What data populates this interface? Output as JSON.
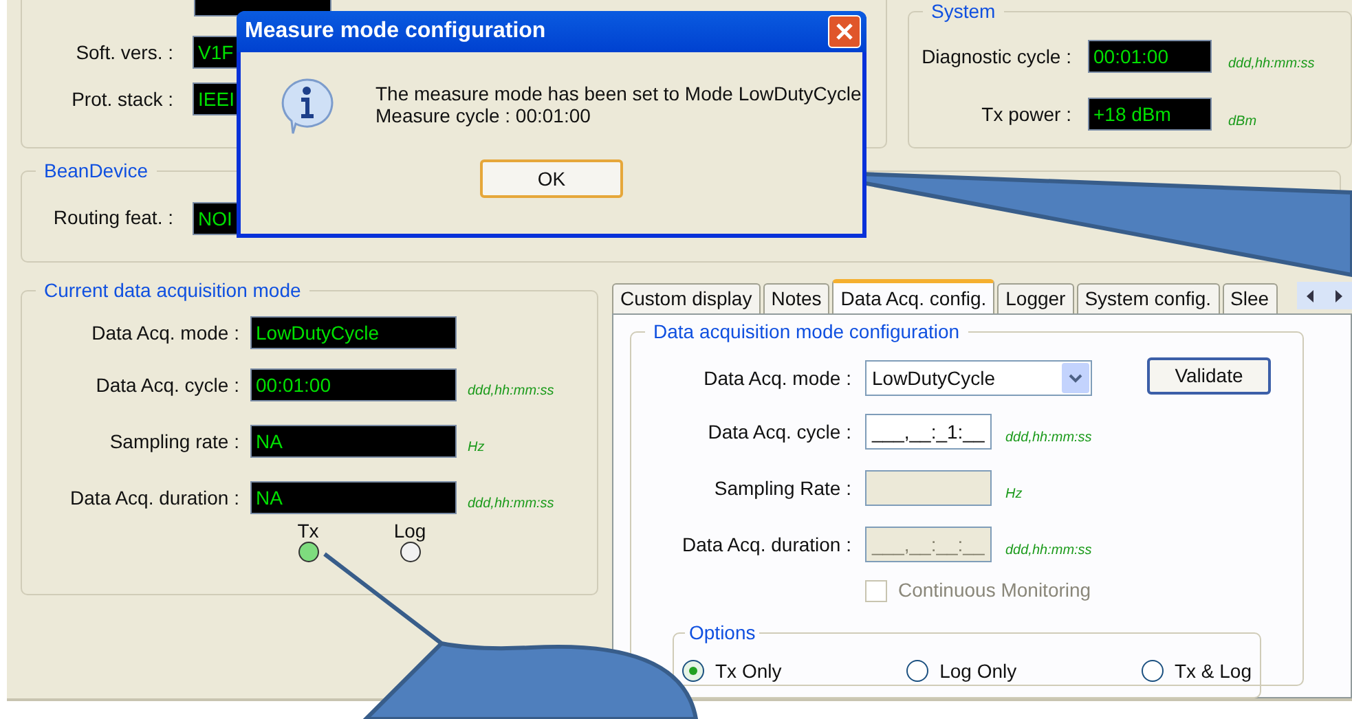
{
  "device_panel": {
    "rows": [
      {
        "label": "Soft. vers. :",
        "value": "V1F"
      },
      {
        "label": "Prot. stack :",
        "value": "IEEI"
      }
    ]
  },
  "system_panel": {
    "title": "System",
    "rows": [
      {
        "label": "Diagnostic cycle :",
        "value": "00:01:00",
        "unit": "ddd,hh:mm:ss"
      },
      {
        "label": "Tx power :",
        "value": "+18 dBm",
        "unit": "dBm"
      }
    ]
  },
  "bean_device": {
    "title": "BeanDevice",
    "rows": [
      {
        "label": "Routing feat. :",
        "value": "NOI"
      }
    ]
  },
  "dialog": {
    "title": "Measure mode configuration",
    "lines": [
      "The measure mode has been set to Mode LowDutyCycle",
      "Measure cycle : 00:01:00"
    ],
    "button": "OK"
  },
  "current_mode": {
    "title": "Current data acquisition mode",
    "rows": [
      {
        "label": "Data Acq. mode :",
        "value": "LowDutyCycle"
      },
      {
        "label": "Data Acq. cycle :",
        "value": "00:01:00",
        "unit": "ddd,hh:mm:ss"
      },
      {
        "label": "Sampling rate :",
        "value": "NA",
        "unit": "Hz"
      },
      {
        "label": "Data Acq. duration :",
        "value": "NA",
        "unit": "ddd,hh:mm:ss"
      }
    ],
    "indicators": [
      {
        "label": "Tx",
        "on": true
      },
      {
        "label": "Log",
        "on": false
      }
    ]
  },
  "tabs": [
    {
      "label": "Custom display",
      "selected": false
    },
    {
      "label": "Notes",
      "selected": false
    },
    {
      "label": "Data Acq. config.",
      "selected": true
    },
    {
      "label": "Logger",
      "selected": false
    },
    {
      "label": "System config.",
      "selected": false
    },
    {
      "label": "Slee",
      "selected": false
    }
  ],
  "config": {
    "title": "Data acquisition mode configuration",
    "rows": [
      {
        "kind": "select",
        "label": "Data Acq. mode :",
        "value": "LowDutyCycle"
      },
      {
        "kind": "input",
        "label": "Data Acq. cycle :",
        "value": "___,__:_1:__",
        "unit": "ddd,hh:mm:ss",
        "disabled": false
      },
      {
        "kind": "input",
        "label": "Sampling Rate :",
        "unit": "Hz",
        "disabled": true
      },
      {
        "kind": "input",
        "label": "Data Acq. duration :",
        "value": "___,__:__:__",
        "unit": "ddd,hh:mm:ss",
        "disabled": true
      }
    ],
    "validate": "Validate",
    "continuous": {
      "label": "Continuous Monitoring",
      "checked": false,
      "disabled": true
    },
    "options": {
      "title": "Options",
      "items": [
        {
          "label": "Tx Only",
          "selected": true
        },
        {
          "label": "Log Only",
          "selected": false
        },
        {
          "label": "Tx & Log",
          "selected": false
        }
      ]
    }
  }
}
